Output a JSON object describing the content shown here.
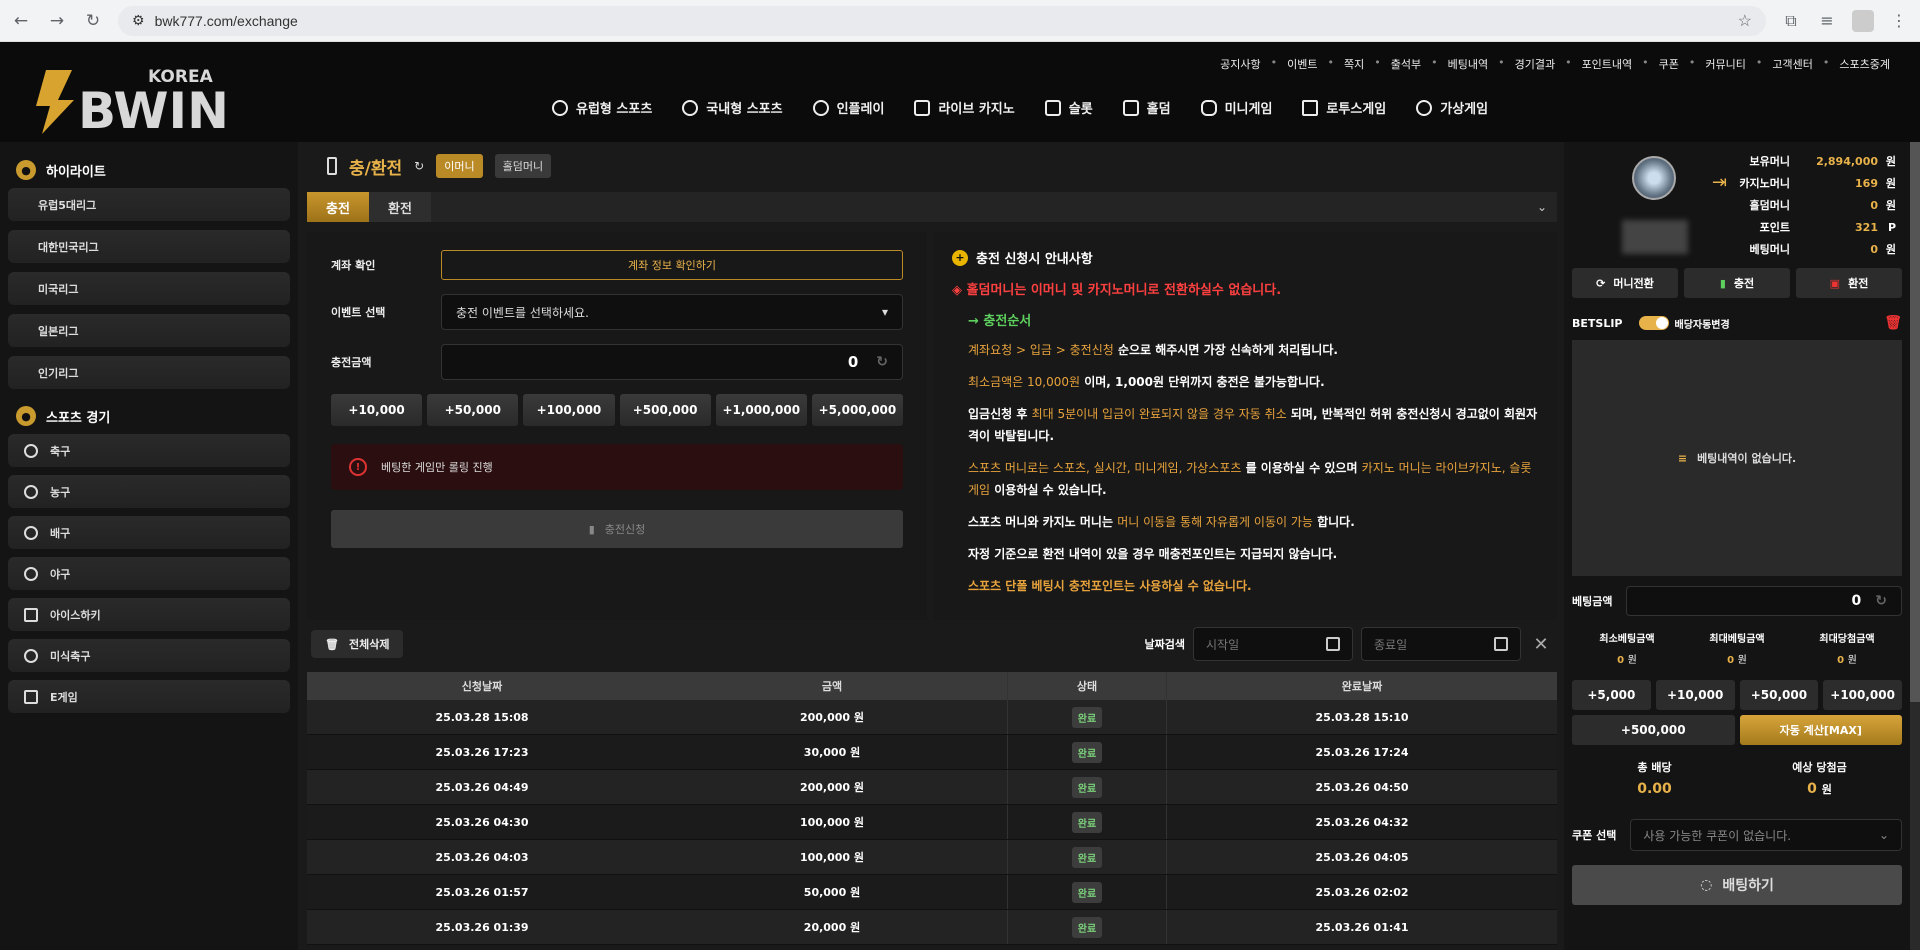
{
  "browser": {
    "url": "bwk777.com/exchange"
  },
  "top_links": [
    "공지사항",
    "이벤트",
    "쪽지",
    "출석부",
    "베팅내역",
    "경기결과",
    "포인트내역",
    "쿠폰",
    "커뮤니티",
    "고객센터",
    "스포츠중계"
  ],
  "main_nav": [
    "유럽형 스포츠",
    "국내형 스포츠",
    "인플레이",
    "라이브 카지노",
    "슬롯",
    "홀덤",
    "미니게임",
    "로투스게임",
    "가상게임"
  ],
  "logo": {
    "small": "KOREA",
    "big": "BWIN"
  },
  "sidebar": {
    "highlight_title": "하이라이트",
    "leagues": [
      "유럽5대리그",
      "대한민국리그",
      "미국리그",
      "일본리그",
      "인기리그"
    ],
    "sports_title": "스포츠 경기",
    "sports": [
      "축구",
      "농구",
      "배구",
      "야구",
      "아이스하키",
      "미식축구",
      "E게임"
    ]
  },
  "page": {
    "title": "충/환전",
    "chips": [
      "이머니",
      "홀덤머니"
    ],
    "tabs": [
      "충전",
      "환전"
    ]
  },
  "form": {
    "account_label": "계좌 확인",
    "account_button": "계좌 정보 확인하기",
    "event_label": "이벤트 선택",
    "event_value": "충전 이벤트를 선택하세요.",
    "amount_label": "충전금액",
    "amount_value": "0",
    "quick": [
      "+10,000",
      "+50,000",
      "+100,000",
      "+500,000",
      "+1,000,000",
      "+5,000,000"
    ],
    "warning": "베팅한 게임만 롤링 진행",
    "submit": "충전신청"
  },
  "info": {
    "title": "충전 신청시 안내사항",
    "red": "◈ 홀덤머니는 이머니 및 카지노머니로 전환하실수 없습니다.",
    "green": "→ 충전순서",
    "p1_o": "계좌요청  >  입금  >  충전신청",
    "p1_w": " 순으로 해주시면 가장 신속하게 처리됩니다.",
    "p2_o": "최소금액은 10,000원",
    "p2_w": " 이며, 1,000원 단위까지 충전은 불가능합니다.",
    "p3_w1": "입금신청 후 ",
    "p3_o": "최대 5분이내 입금이 완료되지 않을 경우 자동 취소",
    "p3_w2": " 되며, 반복적인 허위 충전신청시 경고없이 회원자격이 박탈됩니다.",
    "p4_o1": "스포츠 머니로는 스포츠, 실시간, 미니게임, 가상스포츠",
    "p4_w1": " 를 이용하실 수 있으며 ",
    "p4_o2": "카지노 머니는 라이브카지노, 슬롯게임",
    "p4_w2": " 이용하실 수 있습니다.",
    "p5_w1": "스포츠 머니와 카지노 머니는 ",
    "p5_o": "머니 이동을 통해 자유롭게 이동이 가능",
    "p5_w2": " 합니다.",
    "p6": "자정 기준으로 환전 내역이 있을 경우 매충전포인트는 지급되지 않습니다.",
    "p7": "스포츠 단폴 베팅시 충전포인트는 사용하실 수 없습니다."
  },
  "list": {
    "delete_all": "전체삭제",
    "date_search": "날짜검색",
    "start_placeholder": "시작일",
    "end_placeholder": "종료일",
    "headers": [
      "신청날짜",
      "금액",
      "상태",
      "완료날짜"
    ],
    "rows": [
      [
        "25.03.28 15:08",
        "200,000 원",
        "완료",
        "25.03.28 15:10"
      ],
      [
        "25.03.26 17:23",
        "30,000 원",
        "완료",
        "25.03.26 17:24"
      ],
      [
        "25.03.26 04:49",
        "200,000 원",
        "완료",
        "25.03.26 04:50"
      ],
      [
        "25.03.26 04:30",
        "100,000 원",
        "완료",
        "25.03.26 04:32"
      ],
      [
        "25.03.26 04:03",
        "100,000 원",
        "완료",
        "25.03.26 04:05"
      ],
      [
        "25.03.26 01:57",
        "50,000 원",
        "완료",
        "25.03.26 02:02"
      ],
      [
        "25.03.26 01:39",
        "20,000 원",
        "완료",
        "25.03.26 01:41"
      ]
    ]
  },
  "balances": [
    {
      "label": "보유머니",
      "value": "2,894,000",
      "unit": "원"
    },
    {
      "label": "카지노머니",
      "value": "169",
      "unit": "원"
    },
    {
      "label": "홀덤머니",
      "value": "0",
      "unit": "원"
    },
    {
      "label": "포인트",
      "value": "321",
      "unit": "P"
    },
    {
      "label": "베팅머니",
      "value": "0",
      "unit": "원"
    }
  ],
  "right_buttons": [
    "머니전환",
    "충전",
    "환전"
  ],
  "betslip": {
    "title": "BETSLIP",
    "toggle_label": "배당자동변경",
    "empty": "베팅내역이 없습니다.",
    "amount_label": "베팅금액",
    "amount_value": "0",
    "limits": [
      {
        "label": "최소베팅금액",
        "value": "0",
        "unit": "원"
      },
      {
        "label": "최대베팅금액",
        "value": "0",
        "unit": "원"
      },
      {
        "label": "최대당첨금액",
        "value": "0",
        "unit": "원"
      }
    ],
    "quick": [
      "+5,000",
      "+10,000",
      "+50,000",
      "+100,000"
    ],
    "quick2": "+500,000",
    "auto": "자동 계산[MAX]",
    "total_odds_label": "총 배당",
    "total_odds": "0.00",
    "expected_label": "예상 당첨금",
    "expected": "0",
    "expected_unit": "원",
    "coupon_label": "쿠폰 선택",
    "coupon_value": "사용 가능한 쿠폰이 없습니다.",
    "bet_button": "배팅하기"
  }
}
